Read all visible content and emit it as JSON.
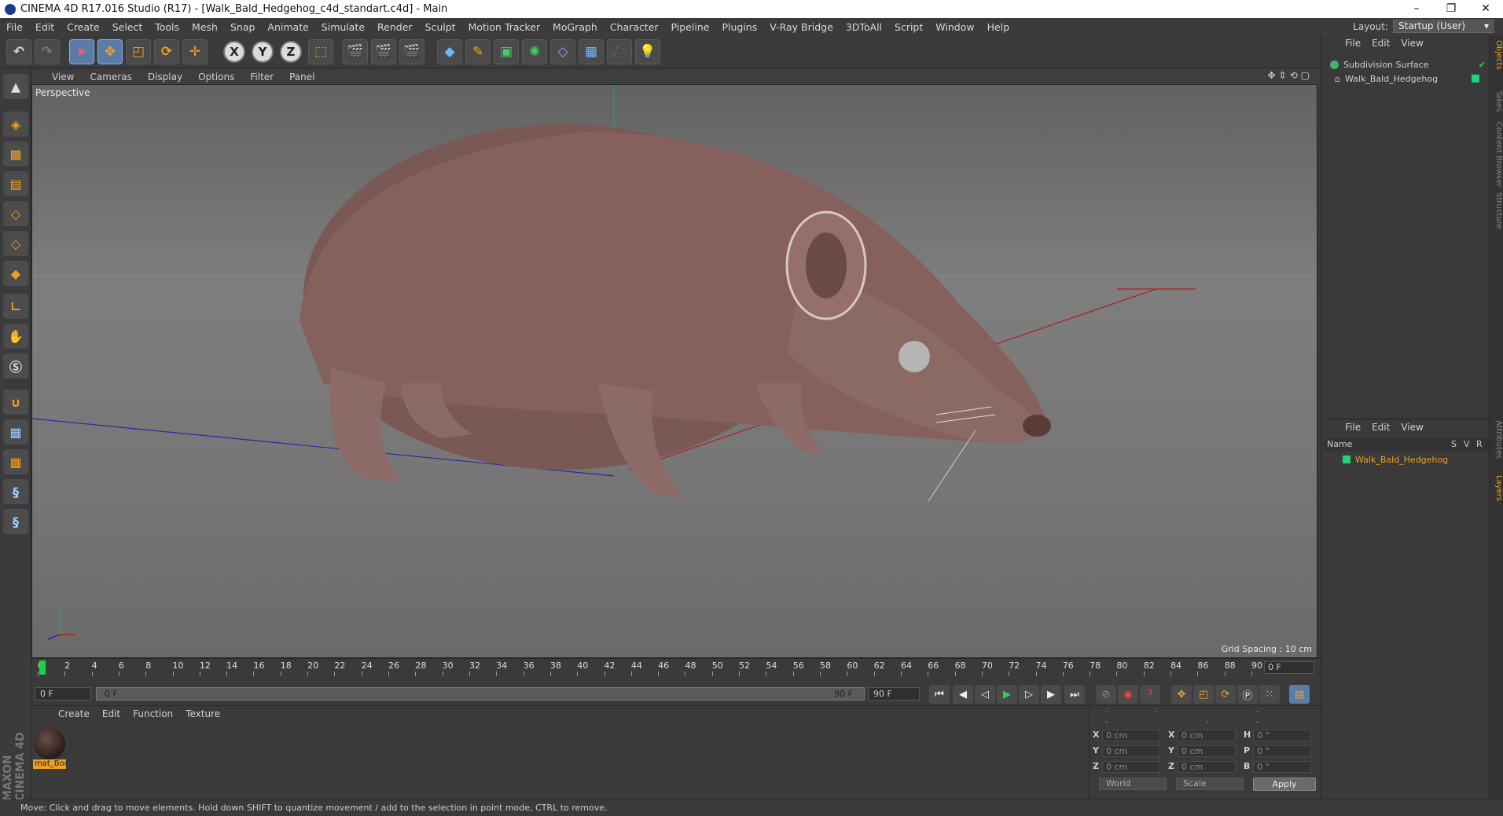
{
  "window": {
    "title": "CINEMA 4D R17.016 Studio (R17) - [Walk_Bald_Hedgehog_c4d_standart.c4d] - Main",
    "minimize": "–",
    "restore": "❐",
    "close": "✕"
  },
  "menu": [
    "File",
    "Edit",
    "Create",
    "Select",
    "Tools",
    "Mesh",
    "Snap",
    "Animate",
    "Simulate",
    "Render",
    "Sculpt",
    "Motion Tracker",
    "MoGraph",
    "Character",
    "Pipeline",
    "Plugins",
    "V-Ray Bridge",
    "3DToAll",
    "Script",
    "Window",
    "Help"
  ],
  "layout": {
    "label": "Layout:",
    "value": "Startup (User)"
  },
  "toolbar": {
    "x": "X",
    "y": "Y",
    "z": "Z"
  },
  "viewport_menu": [
    "View",
    "Cameras",
    "Display",
    "Options",
    "Filter",
    "Panel"
  ],
  "viewport": {
    "label": "Perspective",
    "grid_spacing": "Grid Spacing : 10 cm"
  },
  "timeline": {
    "ticks": [
      "0",
      "2",
      "4",
      "6",
      "8",
      "10",
      "12",
      "14",
      "16",
      "18",
      "20",
      "22",
      "24",
      "26",
      "28",
      "30",
      "32",
      "34",
      "36",
      "38",
      "40",
      "42",
      "44",
      "46",
      "48",
      "50",
      "52",
      "54",
      "56",
      "58",
      "60",
      "62",
      "64",
      "66",
      "68",
      "70",
      "72",
      "74",
      "76",
      "78",
      "80",
      "82",
      "84",
      "86",
      "88",
      "90"
    ],
    "current_frame": "0 F"
  },
  "transport": {
    "start": "0 F",
    "slider_start": "0 F",
    "slider_end": "90 F",
    "end": "90 F"
  },
  "material_menu": [
    "Create",
    "Edit",
    "Function",
    "Texture"
  ],
  "material": {
    "name": "mat_Boc"
  },
  "logo": {
    "text": "MAXON CINEMA 4D"
  },
  "attributes": {
    "header": "-- -- --",
    "x": "X",
    "y": "Y",
    "z": "Z",
    "h": "H",
    "p": "P",
    "b": "B",
    "pos_x": "0 cm",
    "pos_y": "0 cm",
    "pos_z": "0 cm",
    "size_x": "0 cm",
    "size_y": "0 cm",
    "size_z": "0 cm",
    "rot_h": "0 °",
    "rot_p": "0 °",
    "rot_b": "0 °",
    "coord": "World",
    "mode": "Scale",
    "apply": "Apply"
  },
  "object_manager": {
    "menu": [
      "File",
      "Edit",
      "View"
    ],
    "objects": [
      {
        "name": "Subdivision Surface",
        "color": "#46b36a"
      },
      {
        "name": "Walk_Bald_Hedgehog",
        "color": "#1fd47a"
      }
    ]
  },
  "layer_manager": {
    "menu": [
      "File",
      "Edit",
      "View"
    ],
    "col_name": "Name",
    "col_s": "S",
    "col_v": "V",
    "col_r": "R",
    "layer": "Walk_Bald_Hedgehog"
  },
  "side_tabs": [
    "Objects",
    "Takes",
    "Content Browser",
    "Structure",
    "Attributes",
    "Layers"
  ],
  "status": "Move: Click and drag to move elements. Hold down SHIFT to quantize movement / add to the selection in point mode, CTRL to remove."
}
